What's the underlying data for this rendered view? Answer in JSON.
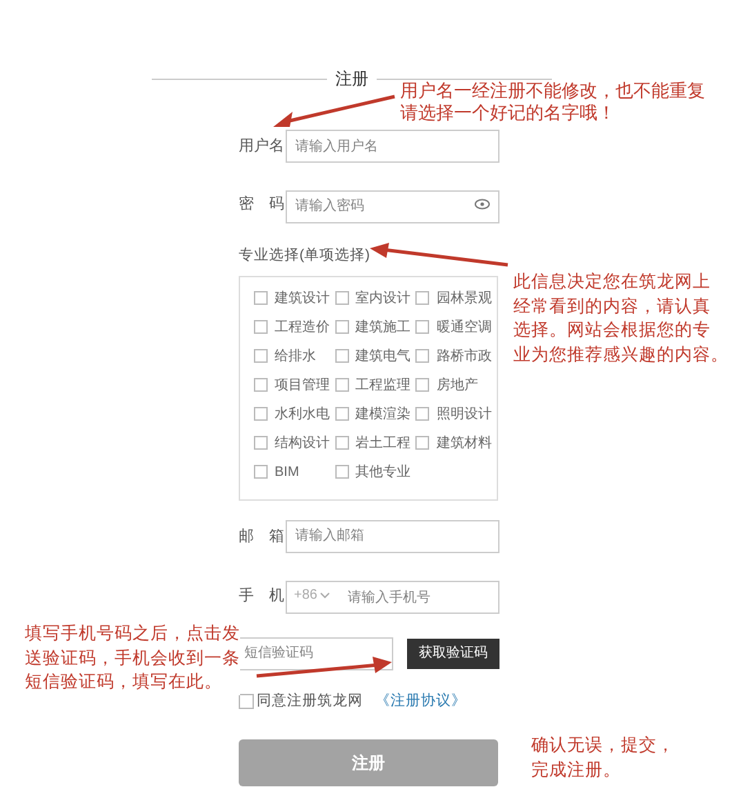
{
  "title": "注册",
  "username": {
    "label": "用户名",
    "placeholder": "请输入用户名"
  },
  "password": {
    "label": "密　码",
    "placeholder": "请输入密码"
  },
  "majors": {
    "label": "专业选择(单项选择)",
    "items": [
      {
        "label": "建筑设计",
        "checked": false
      },
      {
        "label": "室内设计",
        "checked": false
      },
      {
        "label": "园林景观",
        "checked": false
      },
      {
        "label": "工程造价",
        "checked": false
      },
      {
        "label": "建筑施工",
        "checked": false
      },
      {
        "label": "暖通空调",
        "checked": false
      },
      {
        "label": "给排水",
        "checked": false
      },
      {
        "label": "建筑电气",
        "checked": false
      },
      {
        "label": "路桥市政",
        "checked": false
      },
      {
        "label": "项目管理",
        "checked": false
      },
      {
        "label": "工程监理",
        "checked": false
      },
      {
        "label": "房地产",
        "checked": false
      },
      {
        "label": "水利水电",
        "checked": false
      },
      {
        "label": "建模渲染",
        "checked": false
      },
      {
        "label": "照明设计",
        "checked": false
      },
      {
        "label": "结构设计",
        "checked": false
      },
      {
        "label": "岩土工程",
        "checked": false
      },
      {
        "label": "建筑材料",
        "checked": false
      },
      {
        "label": "BIM",
        "checked": false
      },
      {
        "label": "其他专业",
        "checked": false
      }
    ]
  },
  "email": {
    "label": "邮　箱",
    "placeholder": "请输入邮箱"
  },
  "phone": {
    "label": "手　机",
    "country_code": "+86",
    "placeholder": "请输入手机号"
  },
  "sms": {
    "placeholder": "短信验证码",
    "button": "获取验证码"
  },
  "agreement": {
    "checked": false,
    "text": "同意注册筑龙网",
    "link": "《注册协议》"
  },
  "submit": {
    "label": "注册",
    "disabled": true
  },
  "annotations": [
    {
      "lines": [
        "用户名一经注册不能修改，也不能重复",
        "请选择一个好记的名字哦！"
      ]
    },
    {
      "lines": [
        "此信息决定您在筑龙网上",
        "经常看到的内容，请认真",
        "选择。网站会根据您的专",
        "业为您推荐感兴趣的内容。"
      ]
    },
    {
      "lines": [
        "填写手机号码之后，点击发",
        "送验证码，手机会收到一条",
        "短信验证码，填写在此。"
      ]
    },
    {
      "lines": [
        "确认无误，提交，",
        "完成注册。"
      ]
    }
  ]
}
